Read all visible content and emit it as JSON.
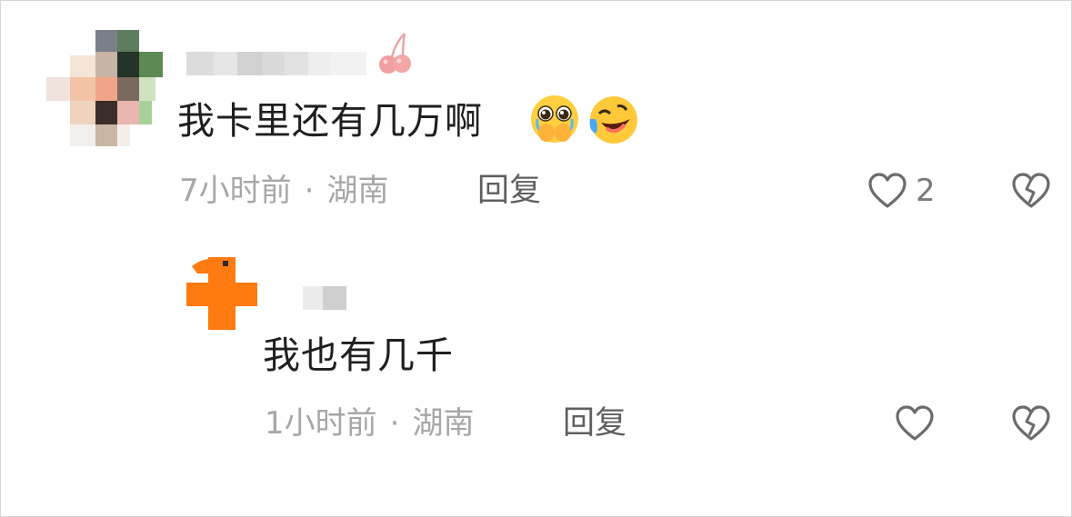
{
  "comments": [
    {
      "text": "我卡里还有几万啊",
      "emojis": [
        "pleading-face-hands-over-mouth-emoji",
        "rolling-on-the-floor-laughing-emoji"
      ],
      "time": "7小时前",
      "separator": "·",
      "location": "湖南",
      "reply_label": "回复",
      "like_count": "2",
      "badge_icon": "cherry-icon"
    },
    {
      "text": "我也有几千",
      "time": "1小时前",
      "separator": "·",
      "location": "湖南",
      "reply_label": "回复",
      "like_count": ""
    }
  ],
  "colors": {
    "text_primary": "#1f1f1f",
    "text_meta": "#a7a7a7",
    "reply_text": "#5f5f5f",
    "icon_stroke": "#6b6b6b",
    "accent_orange": "#ff7a10"
  },
  "icons": {
    "like": "heart-outline-icon",
    "dislike": "broken-heart-outline-icon"
  }
}
